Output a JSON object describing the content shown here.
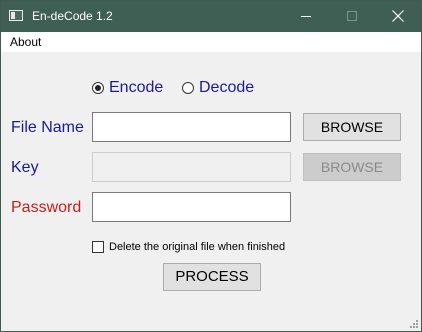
{
  "window": {
    "title": "En-deCode 1.2",
    "titlebar_color": "#3f5f54"
  },
  "menu": {
    "items": [
      "About"
    ]
  },
  "mode": {
    "options": [
      {
        "label": "Encode",
        "checked": true
      },
      {
        "label": "Decode",
        "checked": false
      }
    ]
  },
  "fields": {
    "file_name": {
      "label": "File Name",
      "value": "",
      "label_color": "#1a1a9e"
    },
    "key": {
      "label": "Key",
      "value": "",
      "enabled": false,
      "label_color": "#1a1a9e"
    },
    "password": {
      "label": "Password",
      "value": "",
      "label_color": "#c81e1e"
    }
  },
  "buttons": {
    "browse_file": "BROWSE",
    "browse_key": "BROWSE",
    "process": "PROCESS"
  },
  "options": {
    "delete_original_label": "Delete the original file when finished",
    "delete_original_checked": false
  },
  "icons": {
    "app": "app-window-icon",
    "minimize": "minimize-icon",
    "maximize": "maximize-icon",
    "close": "close-icon",
    "grip": "resize-grip-icon"
  }
}
